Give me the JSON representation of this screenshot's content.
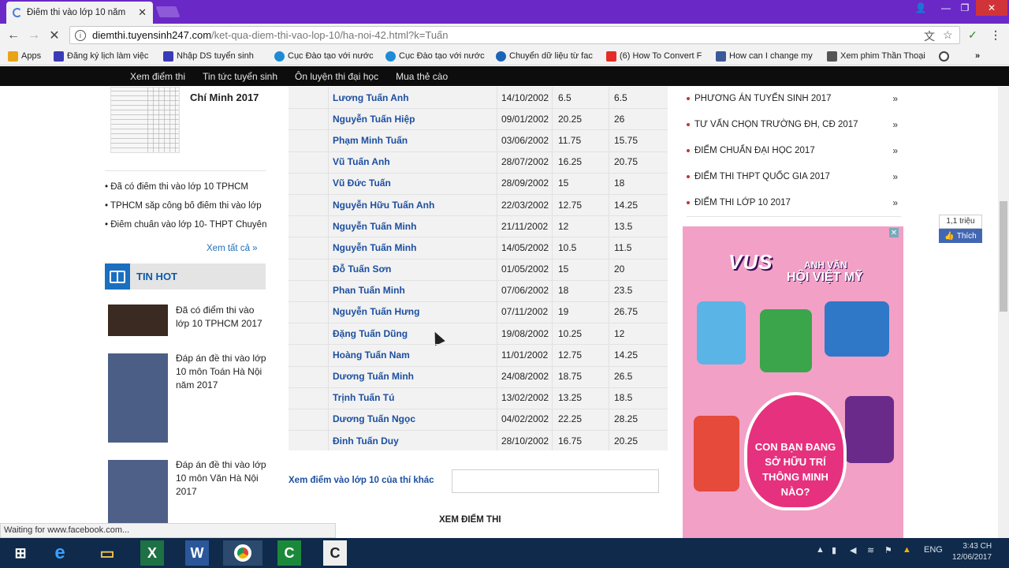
{
  "browser": {
    "tab_title": "Điểm thi vào lớp 10 năm",
    "tab_close": "✕",
    "url_host": "diemthi.tuyensinh247.com",
    "url_path": "/ket-qua-diem-thi-vao-lop-10/ha-noi-42.html?k=Tuấn",
    "window_user": "👤",
    "window_min": "—",
    "window_max": "❐",
    "window_close": "✕",
    "back": "←",
    "forward": "→",
    "reload": "✕",
    "star": "☆",
    "ext": "✓",
    "menu": "⋮",
    "translate": "文",
    "bookmarks": [
      {
        "label": "Apps",
        "color": "#e8a317"
      },
      {
        "label": "Đăng ký lịch làm việc",
        "color": "#3b3bb8"
      },
      {
        "label": "Nhập DS tuyển sinh",
        "color": "#3b3bb8"
      },
      {
        "label": "Cục Đào tạo với nước",
        "color": "#1e8bd6"
      },
      {
        "label": "Cục Đào tạo với nước",
        "color": "#1e8bd6"
      },
      {
        "label": "Chuyển dữ liệu từ fac",
        "color": "#1c64b8"
      },
      {
        "label": "(6) How To Convert F",
        "color": "#e52d27"
      },
      {
        "label": "How can I change my",
        "color": "#3b5998"
      },
      {
        "label": "Xem phim Thần Thoại",
        "color": "#555555"
      }
    ],
    "bookmarks_more": "»",
    "status": "Waiting for www.facebook.com..."
  },
  "sitenav": [
    "Xem điểm thi",
    "Tin tức tuyển sinh",
    "Ôn luyện thi đại học",
    "Mua thẻ cào"
  ],
  "left": {
    "top_title": "Chí Minh 2017",
    "links": [
      "• Đã có điểm thi vào lớp 10 TPHCM",
      "• TPHCM sắp công bố điểm thi vào lớp",
      "• Điểm chuẩn vào lớp 10- THPT Chuyên"
    ],
    "see_all": "Xem tất cả »",
    "hot_title": "TIN HOT",
    "news": [
      "Đã có điểm thi vào lớp 10 TPHCM 2017",
      "Đáp án đề thi vào lớp 10 môn Toán Hà Nội năm 2017",
      "Đáp án đề thi vào lớp 10 môn Văn Hà Nội 2017"
    ]
  },
  "results": [
    {
      "name": "Lương Tuấn Anh",
      "dob": "14/10/2002",
      "s1": "6.5",
      "s2": "6.5"
    },
    {
      "name": "Nguyễn Tuấn Hiệp",
      "dob": "09/01/2002",
      "s1": "20.25",
      "s2": "26"
    },
    {
      "name": "Phạm Minh Tuấn",
      "dob": "03/06/2002",
      "s1": "11.75",
      "s2": "15.75"
    },
    {
      "name": "Vũ Tuấn Anh",
      "dob": "28/07/2002",
      "s1": "16.25",
      "s2": "20.75"
    },
    {
      "name": "Vũ Đức Tuấn",
      "dob": "28/09/2002",
      "s1": "15",
      "s2": "18"
    },
    {
      "name": "Nguyễn Hữu Tuấn Anh",
      "dob": "22/03/2002",
      "s1": "12.75",
      "s2": "14.25"
    },
    {
      "name": "Nguyễn Tuấn Minh",
      "dob": "21/11/2002",
      "s1": "12",
      "s2": "13.5"
    },
    {
      "name": "Nguyễn Tuấn Minh",
      "dob": "14/05/2002",
      "s1": "10.5",
      "s2": "11.5"
    },
    {
      "name": "Đỗ Tuấn Sơn",
      "dob": "01/05/2002",
      "s1": "15",
      "s2": "20"
    },
    {
      "name": "Phan Tuấn Minh",
      "dob": "07/06/2002",
      "s1": "18",
      "s2": "23.5"
    },
    {
      "name": "Nguyễn Tuấn Hưng",
      "dob": "07/11/2002",
      "s1": "19",
      "s2": "26.75"
    },
    {
      "name": "Đặng Tuấn Dũng",
      "dob": "19/08/2002",
      "s1": "10.25",
      "s2": "12"
    },
    {
      "name": "Hoàng Tuấn Nam",
      "dob": "11/01/2002",
      "s1": "12.75",
      "s2": "14.25"
    },
    {
      "name": "Dương Tuấn Minh",
      "dob": "24/08/2002",
      "s1": "18.75",
      "s2": "26.5"
    },
    {
      "name": "Trịnh Tuấn Tú",
      "dob": "13/02/2002",
      "s1": "13.25",
      "s2": "18.5"
    },
    {
      "name": "Dương Tuấn Ngọc",
      "dob": "04/02/2002",
      "s1": "22.25",
      "s2": "28.25"
    },
    {
      "name": "Đinh Tuấn Duy",
      "dob": "28/10/2002",
      "s1": "16.75",
      "s2": "20.25"
    }
  ],
  "search": {
    "label": "Xem điểm vào lớp 10 của thí khác",
    "placeholder": "",
    "button": "XEM ĐIỂM THI"
  },
  "right": {
    "links": [
      "PHƯƠNG ÁN TUYỂN SINH 2017",
      "TƯ VẤN CHỌN TRƯỜNG ĐH, CĐ 2017",
      "ĐIỂM CHUẨN ĐẠI HỌC 2017",
      "ĐIỂM THI THPT QUỐC GIA 2017",
      "ĐIỂM THI LỚP 10 2017"
    ],
    "arrow": "»"
  },
  "ad": {
    "brand1": "VUS",
    "brand2_line1": "ANH VĂN",
    "brand2_line2": "HỘI VIỆT MỸ",
    "slogan": "CON BẠN ĐANG SỞ HỮU TRÍ THÔNG MINH NÀO?",
    "close": "✕"
  },
  "facebook": {
    "count": "1,1 triệu",
    "like": "Thích"
  },
  "taskbar": {
    "lang": "ENG",
    "time": "3:43 CH",
    "date": "12/06/2017",
    "chevron": "▲"
  }
}
